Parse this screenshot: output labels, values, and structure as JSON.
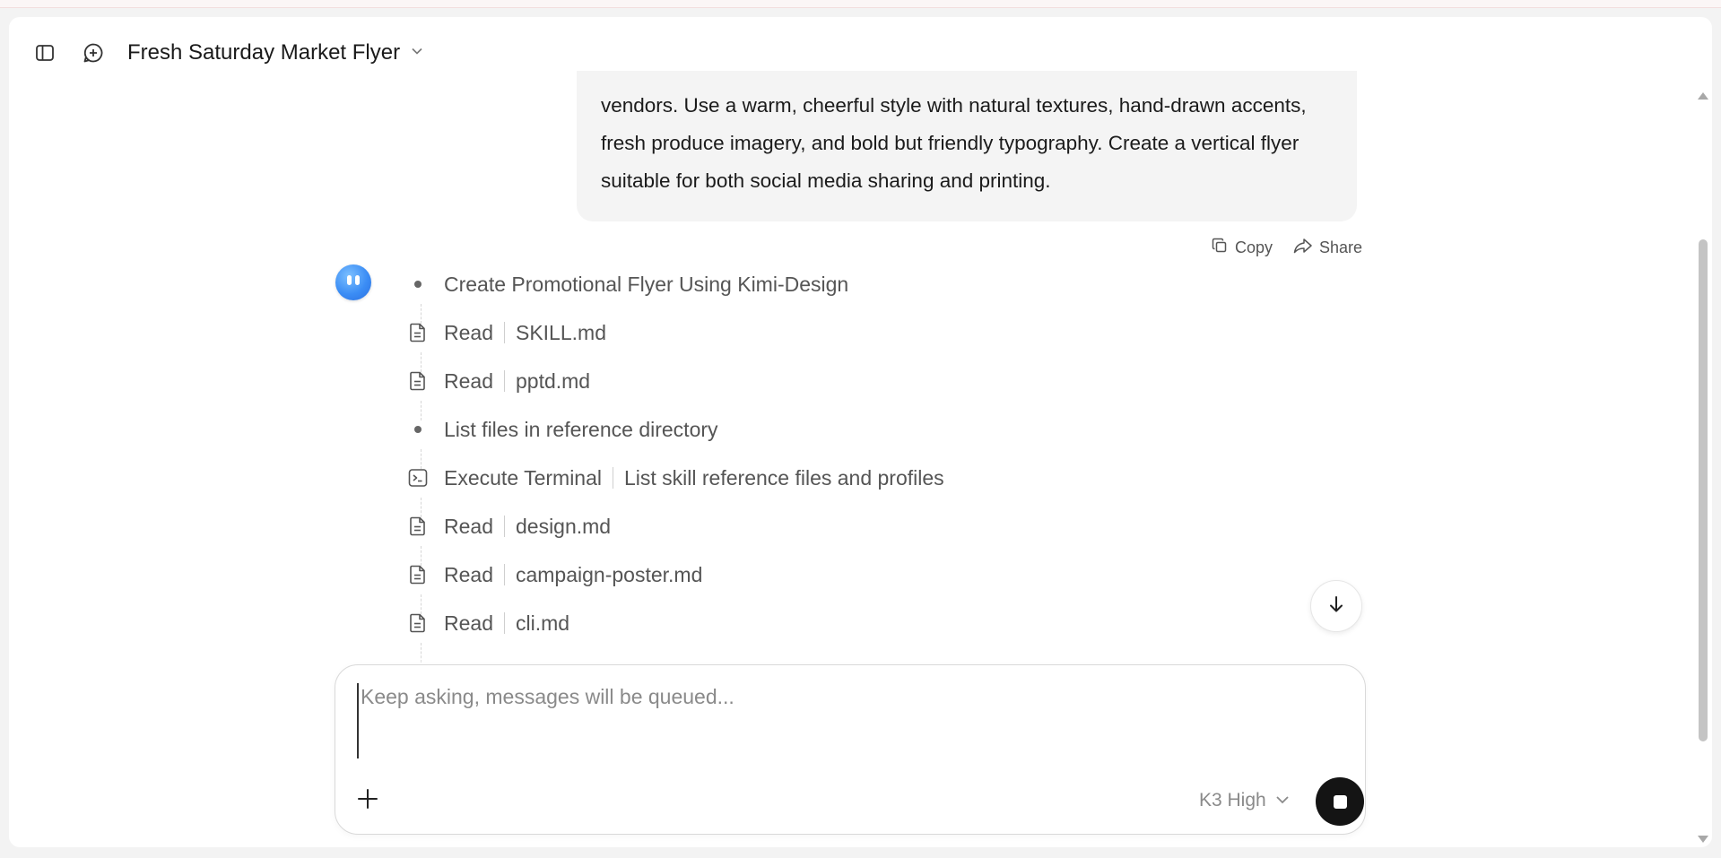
{
  "window": {
    "title": "Fresh Saturday Market Flyer"
  },
  "user_message": {
    "lines": [
      "vendors. Use a warm, cheerful style with natural textures, hand-drawn accents,",
      "fresh produce imagery, and bold but friendly typography. Create a vertical flyer",
      "suitable for both social media sharing and printing."
    ],
    "copy_label": "Copy",
    "share_label": "Share"
  },
  "steps": [
    {
      "icon": "bullet-dot-icon",
      "action": "Create Promotional Flyer Using Kimi-Design",
      "detail": ""
    },
    {
      "icon": "document-icon",
      "action": "Read",
      "detail": "SKILL.md"
    },
    {
      "icon": "document-icon",
      "action": "Read",
      "detail": "pptd.md"
    },
    {
      "icon": "bullet-dot-icon",
      "action": "List files in reference directory",
      "detail": ""
    },
    {
      "icon": "terminal-icon",
      "action": "Execute Terminal",
      "detail": "List skill reference files and profiles"
    },
    {
      "icon": "document-icon",
      "action": "Read",
      "detail": "design.md"
    },
    {
      "icon": "document-icon",
      "action": "Read",
      "detail": "campaign-poster.md"
    },
    {
      "icon": "document-icon",
      "action": "Read",
      "detail": "cli.md"
    }
  ],
  "composer": {
    "placeholder": "Keep asking, messages will be queued...",
    "value": "",
    "model_label": "K3 High"
  },
  "colors": {
    "accent": "#3b8df5",
    "stop_button": "#141414"
  }
}
